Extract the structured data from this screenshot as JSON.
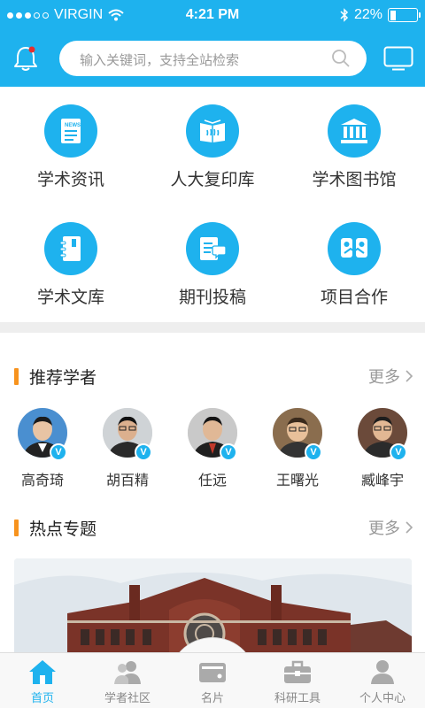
{
  "status_bar": {
    "carrier": "VIRGIN",
    "time": "4:21 PM",
    "battery": "22%",
    "battery_level": 0.22,
    "signal_bars": 3,
    "signal_total": 5
  },
  "header": {
    "search_placeholder": "输入关键词，支持全站检索",
    "icons": [
      "bell-icon",
      "search-icon",
      "tv-icon"
    ],
    "accent_color": "#1eb2ee"
  },
  "grid": [
    {
      "label": "学术资讯",
      "icon": "news-icon"
    },
    {
      "label": "人大复印库",
      "icon": "book-icon"
    },
    {
      "label": "学术图书馆",
      "icon": "library-icon"
    },
    {
      "label": "学术文库",
      "icon": "notebook-icon"
    },
    {
      "label": "期刊投稿",
      "icon": "submit-icon"
    },
    {
      "label": "项目合作",
      "icon": "cooperation-icon"
    }
  ],
  "scholars_section": {
    "title": "推荐学者",
    "more": "更多",
    "badge": "V",
    "items": [
      {
        "name": "高奇琦"
      },
      {
        "name": "胡百精"
      },
      {
        "name": "任远"
      },
      {
        "name": "王曙光"
      },
      {
        "name": "臧峰宇"
      }
    ]
  },
  "topics_section": {
    "title": "热点专题",
    "more": "更多"
  },
  "tabbar": {
    "items": [
      {
        "label": "首页",
        "icon": "home-icon",
        "active": true
      },
      {
        "label": "学者社区",
        "icon": "people-icon",
        "active": false
      },
      {
        "label": "名片",
        "icon": "card-icon",
        "active": false
      },
      {
        "label": "科研工具",
        "icon": "toolbox-icon",
        "active": false
      },
      {
        "label": "个人中心",
        "icon": "user-icon",
        "active": false
      }
    ]
  }
}
